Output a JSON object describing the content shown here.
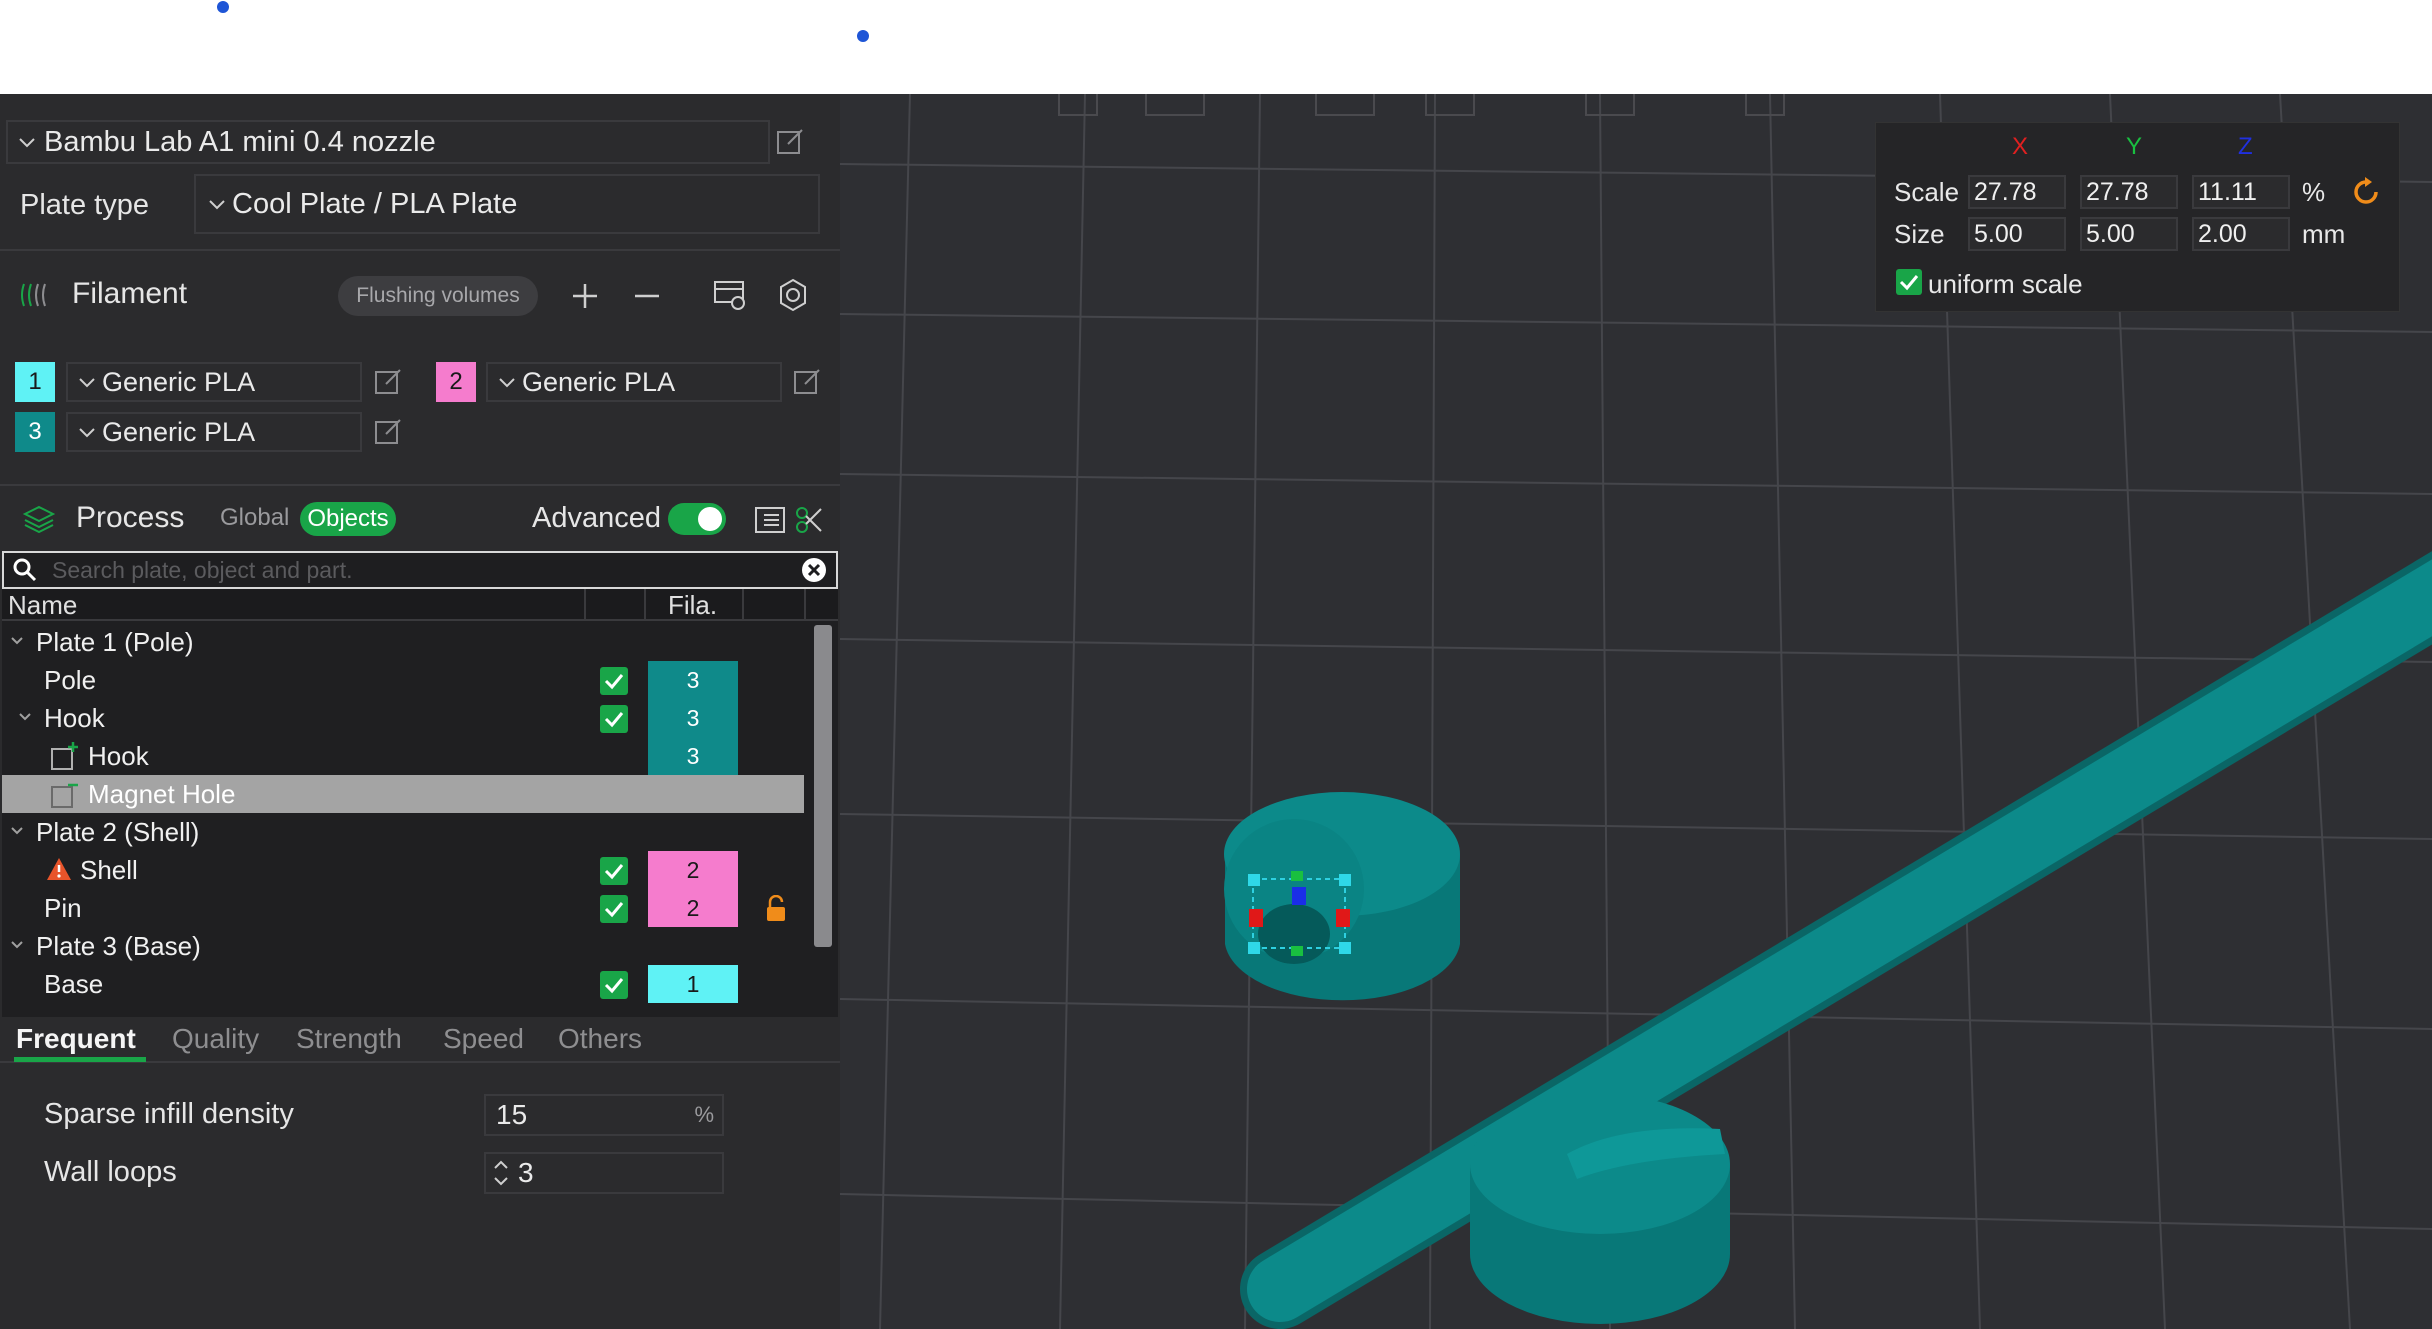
{
  "printer": {
    "name": "Bambu Lab A1 mini 0.4 nozzle",
    "plate_type_label": "Plate type",
    "plate_type_value": "Cool Plate / PLA Plate"
  },
  "filament": {
    "title": "Filament",
    "flushing_label": "Flushing volumes",
    "slots": [
      {
        "num": "1",
        "name": "Generic PLA",
        "color": "#5ff2f5"
      },
      {
        "num": "2",
        "name": "Generic PLA",
        "color": "#f57ccd"
      },
      {
        "num": "3",
        "name": "Generic PLA",
        "color": "#0f8a8a"
      }
    ]
  },
  "process": {
    "title": "Process",
    "global_label": "Global",
    "objects_label": "Objects",
    "advanced_label": "Advanced",
    "advanced_on": true
  },
  "search": {
    "placeholder": "Search plate, object and part."
  },
  "tree": {
    "col_name": "Name",
    "col_fila": "Fila.",
    "rows": [
      {
        "label": "Plate 1 (Pole)",
        "fila": ""
      },
      {
        "label": "Pole",
        "fila": "3",
        "fila_color": "#0f8a8a"
      },
      {
        "label": "Hook",
        "fila": "3",
        "fila_color": "#0f8a8a"
      },
      {
        "label": "Hook",
        "fila": "3",
        "fila_color": "#0f8a8a"
      },
      {
        "label": "Magnet Hole",
        "fila": ""
      },
      {
        "label": "Plate 2 (Shell)",
        "fila": ""
      },
      {
        "label": "Shell",
        "fila": "2",
        "fila_color": "#f57ccd"
      },
      {
        "label": "Pin",
        "fila": "2",
        "fila_color": "#f57ccd"
      },
      {
        "label": "Plate 3 (Base)",
        "fila": ""
      },
      {
        "label": "Base",
        "fila": "1",
        "fila_color": "#5ff2f5"
      }
    ]
  },
  "tabs": [
    "Frequent",
    "Quality",
    "Strength",
    "Speed",
    "Others"
  ],
  "settings": {
    "infill_label": "Sparse infill density",
    "infill_value": "15",
    "infill_unit": "%",
    "wall_label": "Wall loops",
    "wall_value": "3"
  },
  "gizmo": {
    "axis_x": "X",
    "axis_y": "Y",
    "axis_z": "Z",
    "scale_label": "Scale",
    "scale_x": "27.78",
    "scale_y": "27.78",
    "scale_z": "11.11",
    "scale_unit": "%",
    "size_label": "Size",
    "size_x": "5.00",
    "size_y": "5.00",
    "size_z": "2.00",
    "size_unit": "mm",
    "uniform_label": "uniform scale"
  },
  "colors": {
    "accent": "#19a548",
    "model": "#0b8a8a"
  }
}
